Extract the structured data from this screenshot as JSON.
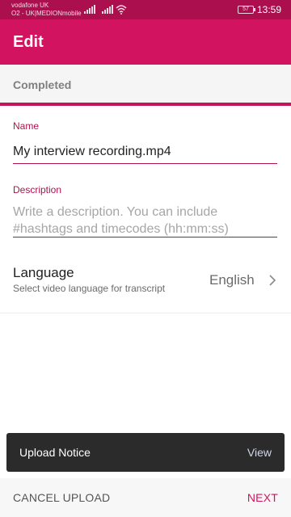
{
  "status_bar": {
    "carrier_1": "vodafone UK",
    "carrier_2": "O2 - UK|MEDIONmobile",
    "battery": "57",
    "time": "13:59",
    "icons": [
      "signal-icon",
      "signal-icon",
      "wifi-icon",
      "battery-icon"
    ]
  },
  "app_bar": {
    "title": "Edit"
  },
  "upload": {
    "status": "Completed"
  },
  "form": {
    "name_label": "Name",
    "name_value": "My interview recording.mp4",
    "description_label": "Description",
    "description_placeholder": "Write a description. You can include #hashtags and timecodes (hh:mm:ss)",
    "description_value": ""
  },
  "language": {
    "title": "Language",
    "subtitle": "Select video language for transcript",
    "value": "English",
    "icon": "chevron-right-icon"
  },
  "snackbar": {
    "message": "Upload Notice",
    "action": "View"
  },
  "bottom_bar": {
    "cancel_label": "CANCEL UPLOAD",
    "next_label": "NEXT"
  },
  "colors": {
    "status_bar": "#ac0f4e",
    "primary": "#d2135f",
    "accent_text": "#b0124d",
    "snackbar": "#2b2b2b"
  }
}
